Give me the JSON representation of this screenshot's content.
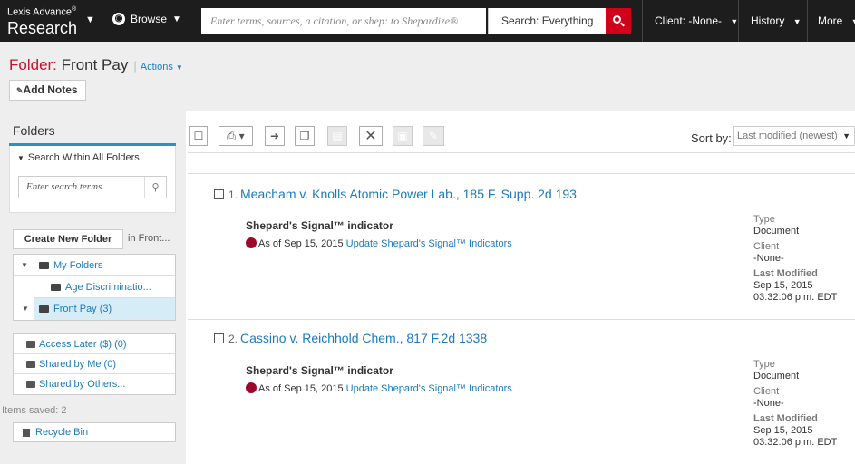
{
  "topbar": {
    "brand_small": "Lexis Advance",
    "brand_reg": "®",
    "brand_big": "Research",
    "browse_label": "Browse",
    "search_placeholder": "Enter terms, sources, a citation, or shep: to Shepardize®",
    "search_scope": "Search: Everything",
    "client_label": "Client: -None-",
    "history_label": "History",
    "more_label": "More"
  },
  "folder_header": {
    "label": "Folder:",
    "name": "Front Pay",
    "actions_label": "Actions",
    "add_notes_label": "Add Notes"
  },
  "sidebar": {
    "title": "Folders",
    "search_within_label": "Search Within All Folders",
    "search_placeholder": "Enter search terms",
    "create_folder_label": "Create New Folder",
    "create_in_label": "in Front...",
    "tree": {
      "my_folders": "My Folders",
      "age_discrimination": "Age Discriminatio...",
      "front_pay": "Front Pay (3)"
    },
    "access_later": "Access Later ($) (0)",
    "shared_by_me": "Shared by Me (0)",
    "shared_by_others": "Shared by Others...",
    "items_saved": "Items saved: 2",
    "recycle_bin": "Recycle Bin"
  },
  "toolbar": {
    "sort_label": "Sort by:",
    "sort_value": "Last modified (newest)"
  },
  "results": [
    {
      "number": "1.",
      "title": "Meacham v. Knolls Atomic Power Lab., 185 F. Supp. 2d 193",
      "signal_heading": "Shepard's Signal™ indicator",
      "signal_date": "As of Sep 15, 2015",
      "signal_link": "Update Shepard's Signal™ Indicators",
      "type_label": "Type",
      "type_value": "Document",
      "client_label": "Client",
      "client_value": "-None-",
      "modified_label": "Last Modified",
      "modified_date": "Sep 15, 2015",
      "modified_time": "03:32:06 p.m. EDT"
    },
    {
      "number": "2.",
      "title": "Cassino v. Reichhold Chem., 817 F.2d 1338",
      "signal_heading": "Shepard's Signal™ indicator",
      "signal_date": "As of Sep 15, 2015",
      "signal_link": "Update Shepard's Signal™ Indicators",
      "type_label": "Type",
      "type_value": "Document",
      "client_label": "Client",
      "client_value": "-None-",
      "modified_label": "Last Modified",
      "modified_date": "Sep 15, 2015",
      "modified_time": "03:32:06 p.m. EDT"
    }
  ],
  "colors": {
    "accent_red": "#c8102e",
    "link_blue": "#1a7bbd",
    "signal_red": "#9b0a2a",
    "topbar_bg": "#1d1d1d"
  }
}
